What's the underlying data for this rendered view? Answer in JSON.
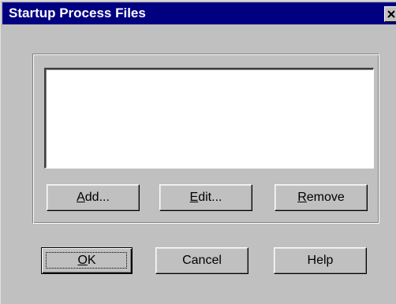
{
  "dialog": {
    "title": "Startup Process Files",
    "close_icon": "close-icon"
  },
  "list": {
    "items": []
  },
  "group_buttons": {
    "add": {
      "mnemonic": "A",
      "rest": "dd..."
    },
    "edit": {
      "mnemonic": "E",
      "rest": "dit..."
    },
    "remove": {
      "mnemonic": "R",
      "rest": "emove"
    }
  },
  "footer_buttons": {
    "ok": {
      "mnemonic": "O",
      "rest": "K"
    },
    "cancel": "Cancel",
    "help": "Help"
  },
  "colors": {
    "titlebar": "#000080",
    "face": "#c0c0c0",
    "list_bg": "#ffffff"
  }
}
